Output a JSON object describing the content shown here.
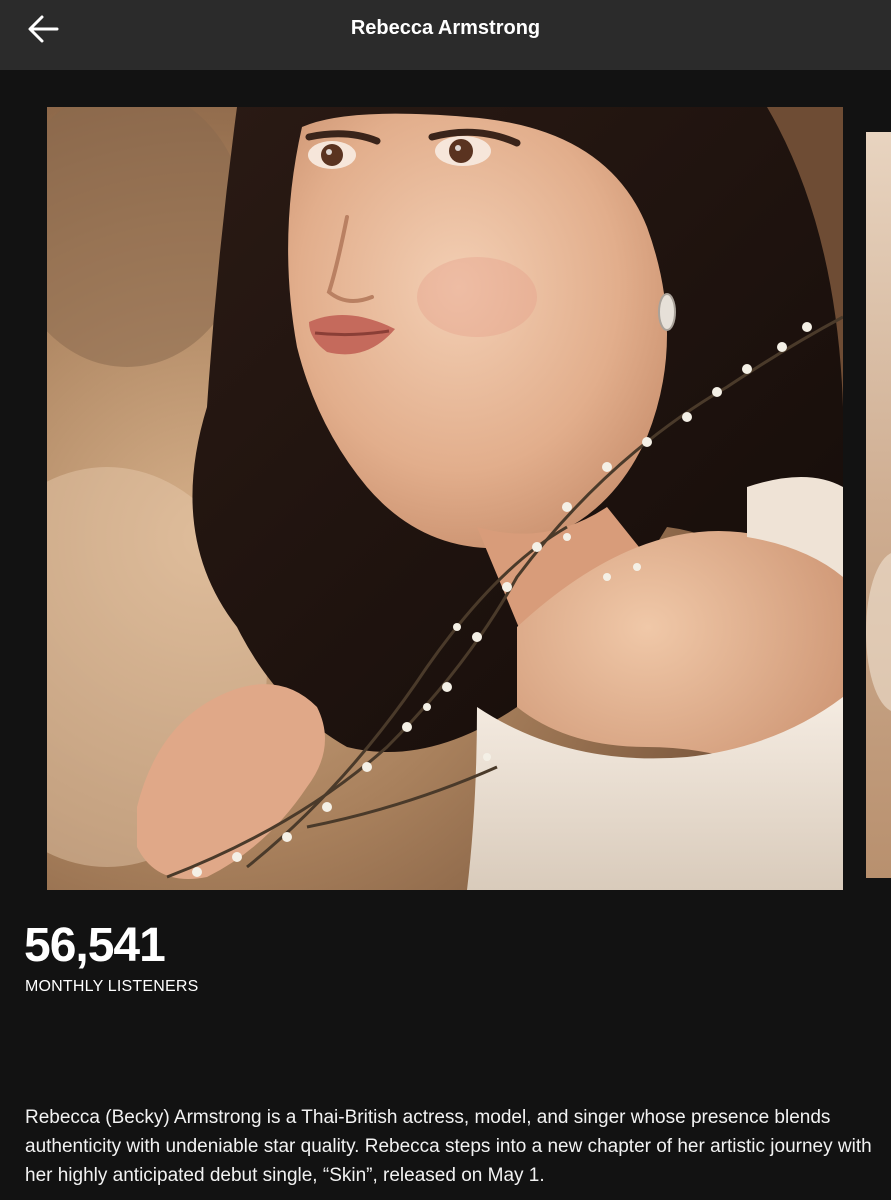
{
  "header": {
    "title": "Rebecca Armstrong",
    "back_icon": "arrow-left-icon"
  },
  "gallery": {
    "main_photo": "artist-photo",
    "next_photo": "artist-photo-next"
  },
  "stats": {
    "monthly_listeners": "56,541",
    "monthly_listeners_label": "MONTHLY LISTENERS"
  },
  "bio": {
    "text": "Rebecca (Becky) Armstrong is a Thai-British actress, model, and singer whose presence blends authenticity with undeniable star quality. Rebecca steps into a new chapter of her artistic journey with her highly anticipated debut single, “Skin”, released on May 1."
  },
  "colors": {
    "background": "#121212",
    "topbar": "#2b2b2b",
    "text": "#ffffff"
  }
}
